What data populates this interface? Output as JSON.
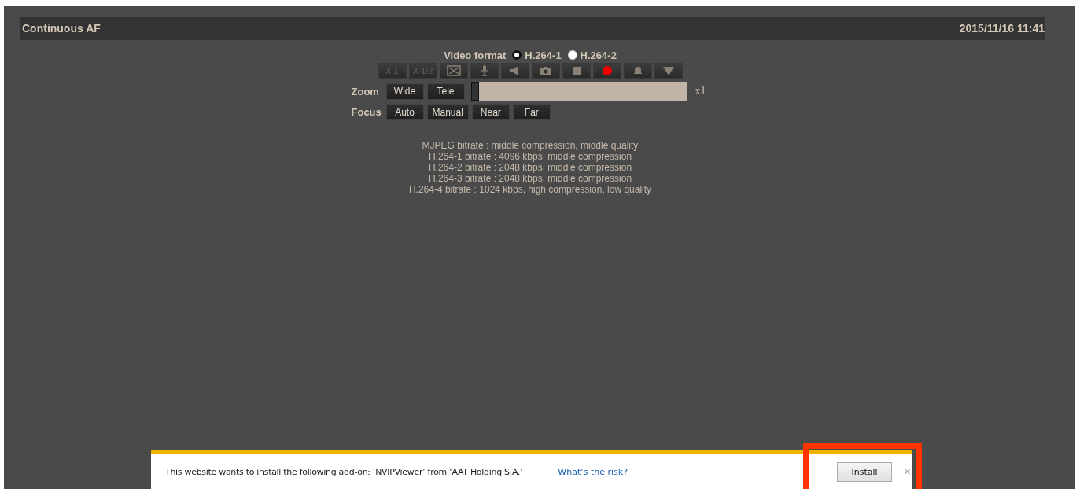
{
  "header": {
    "title": "Continuous AF",
    "datetime": "2015/11/16 11:41"
  },
  "video_format": {
    "label": "Video format",
    "options": [
      {
        "label": "H.264-1",
        "selected": true
      },
      {
        "label": "H.264-2",
        "selected": false
      }
    ]
  },
  "toolbar": [
    {
      "kind": "text",
      "label": "X 1"
    },
    {
      "kind": "text",
      "label": "X 1/2"
    },
    {
      "kind": "fullscreen"
    },
    {
      "kind": "mic"
    },
    {
      "kind": "speaker"
    },
    {
      "kind": "camera"
    },
    {
      "kind": "stop"
    },
    {
      "kind": "record"
    },
    {
      "kind": "bell"
    },
    {
      "kind": "down"
    }
  ],
  "zoom": {
    "label": "Zoom",
    "buttons": [
      "Wide",
      "Tele"
    ],
    "level": 0,
    "reading": "x1"
  },
  "focus": {
    "label": "Focus",
    "buttons": [
      "Auto",
      "Manual",
      "Near",
      "Far"
    ]
  },
  "bitrates": [
    "MJPEG bitrate : middle compression, middle quality",
    "H.264-1 bitrate : 4096 kbps, middle compression",
    "H.264-2 bitrate : 2048 kbps, middle compression",
    "H.264-3 bitrate : 2048 kbps, middle compression",
    "H.264-4 bitrate : 1024 kbps, high compression, low quality"
  ],
  "notification": {
    "message": "This website wants to install the following add-on: ‘NVIPViewer’ from ‘AAT Holding  S.A.’",
    "link": "What’s the risk?",
    "button": "Install",
    "button_highlighted": true,
    "close": "×"
  }
}
